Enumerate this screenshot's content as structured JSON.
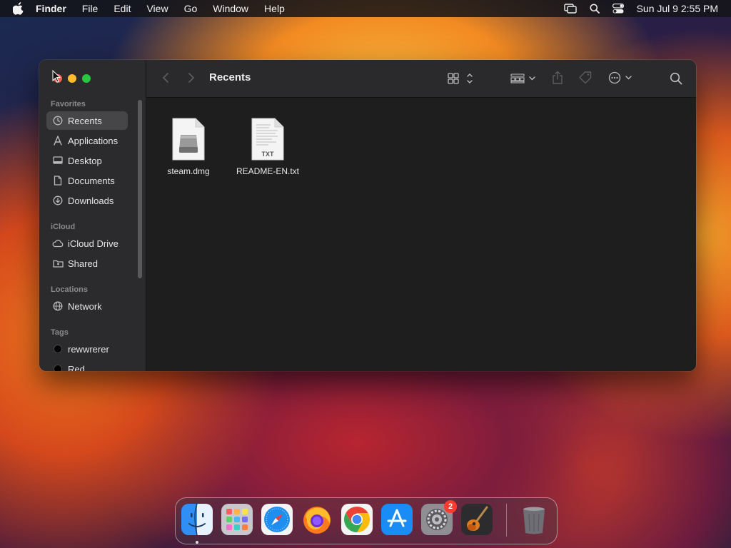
{
  "menubar": {
    "app_name": "Finder",
    "items": [
      "File",
      "Edit",
      "View",
      "Go",
      "Window",
      "Help"
    ],
    "clock": "Sun Jul 9  2:55 PM"
  },
  "window": {
    "title": "Recents",
    "sidebar": {
      "favorites_title": "Favorites",
      "favorites": [
        {
          "label": "Recents",
          "icon": "clock-icon"
        },
        {
          "label": "Applications",
          "icon": "applications-icon"
        },
        {
          "label": "Desktop",
          "icon": "desktop-icon"
        },
        {
          "label": "Documents",
          "icon": "document-icon"
        },
        {
          "label": "Downloads",
          "icon": "download-icon"
        }
      ],
      "icloud_title": "iCloud",
      "icloud": [
        {
          "label": "iCloud Drive",
          "icon": "cloud-icon"
        },
        {
          "label": "Shared",
          "icon": "shared-folder-icon"
        }
      ],
      "locations_title": "Locations",
      "locations": [
        {
          "label": "Network",
          "icon": "network-icon"
        }
      ],
      "tags_title": "Tags",
      "tags": [
        {
          "label": "rewwrerer",
          "color": "#000000"
        },
        {
          "label": "Red",
          "color": "#000000"
        }
      ]
    },
    "files": [
      {
        "name": "steam.dmg",
        "icon": "disk-image-icon"
      },
      {
        "name": "README-EN.txt",
        "icon": "text-file-icon",
        "badge": "TXT"
      }
    ]
  },
  "dock": {
    "apps": [
      {
        "name": "Finder",
        "icon": "finder-icon"
      },
      {
        "name": "Launchpad",
        "icon": "launchpad-icon"
      },
      {
        "name": "Safari",
        "icon": "safari-icon"
      },
      {
        "name": "Firefox",
        "icon": "firefox-icon"
      },
      {
        "name": "Chrome",
        "icon": "chrome-icon"
      },
      {
        "name": "App Store",
        "icon": "app-store-icon"
      },
      {
        "name": "System Settings",
        "icon": "settings-icon",
        "badge": "2"
      },
      {
        "name": "GarageBand",
        "icon": "garageband-icon"
      },
      {
        "name": "Trash",
        "icon": "trash-icon"
      }
    ]
  },
  "colors": {
    "close": "#ff5f57",
    "minimize": "#febc2e",
    "maximize": "#28c840",
    "badge": "#ff3b30"
  }
}
